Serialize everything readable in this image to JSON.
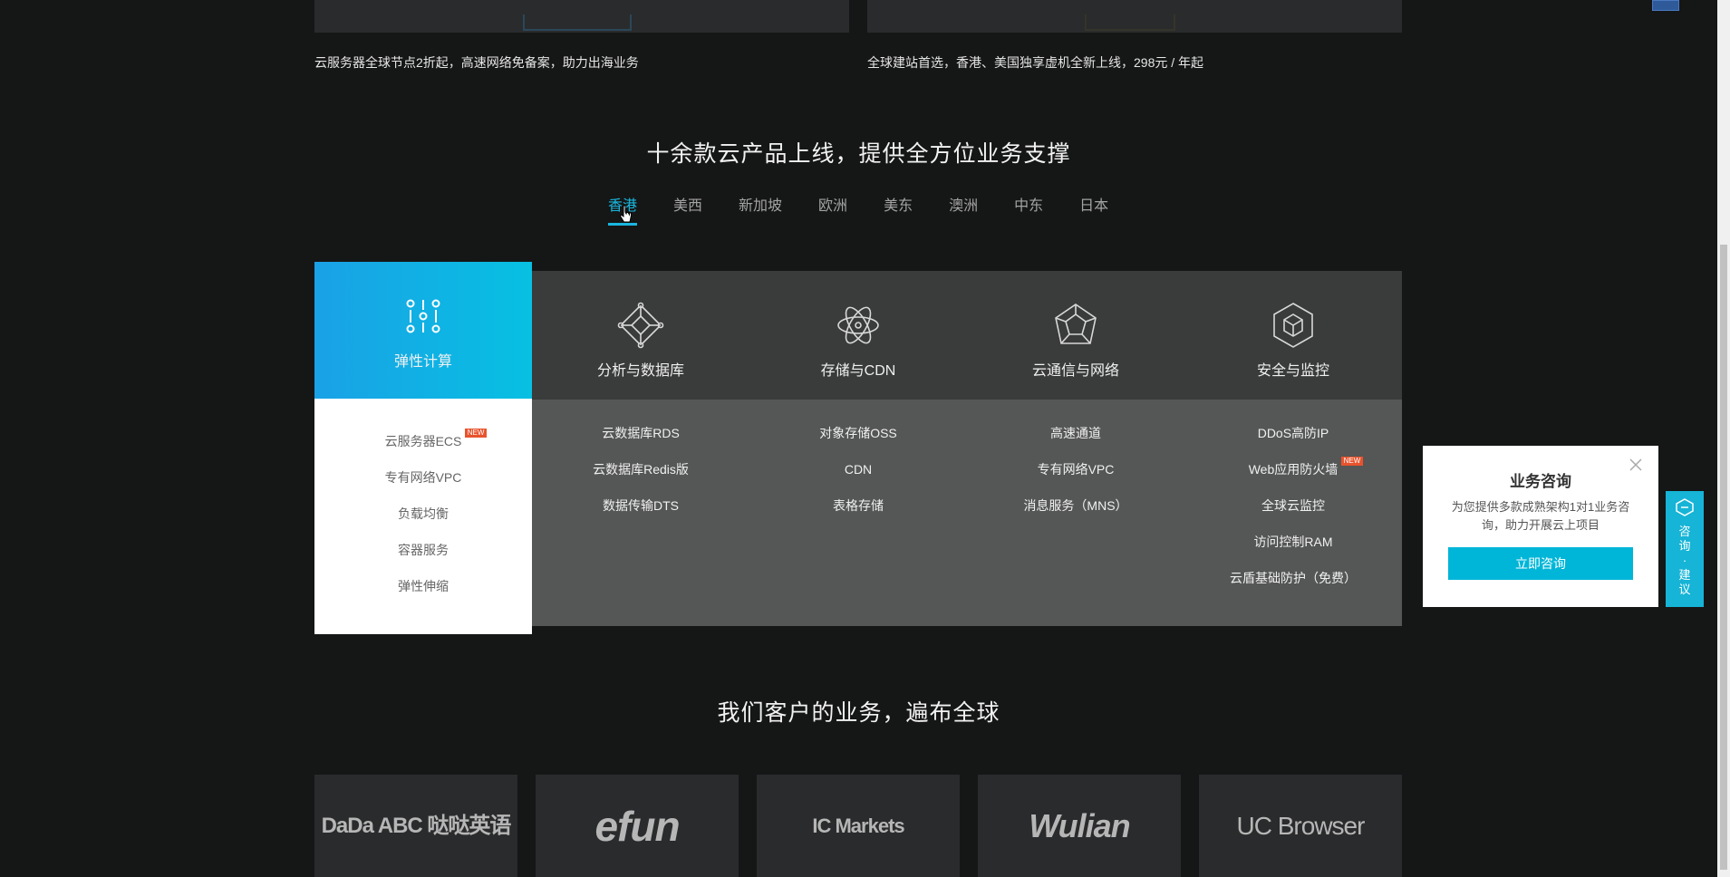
{
  "banners": [
    {
      "caption": "云服务器全球节点2折起，高速网络免备案，助力出海业务"
    },
    {
      "caption": "全球建站首选，香港、美国独享虚机全新上线，298元 / 年起"
    }
  ],
  "products_section": {
    "title": "十余款云产品上线，提供全方位业务支撑",
    "tabs": [
      "香港",
      "美西",
      "新加坡",
      "欧洲",
      "美东",
      "澳洲",
      "中东",
      "日本"
    ],
    "active_tab": "香港",
    "columns": [
      {
        "title": "弹性计算",
        "icon": "compute-grid-icon",
        "active": true,
        "items": [
          {
            "label": "云服务器ECS",
            "badge": "NEW"
          },
          {
            "label": "专有网络VPC"
          },
          {
            "label": "负载均衡"
          },
          {
            "label": "容器服务"
          },
          {
            "label": "弹性伸缩"
          }
        ]
      },
      {
        "title": "分析与数据库",
        "icon": "database-network-icon",
        "items": [
          {
            "label": "云数据库RDS"
          },
          {
            "label": "云数据库Redis版"
          },
          {
            "label": "数据传输DTS"
          }
        ]
      },
      {
        "title": "存储与CDN",
        "icon": "atom-storage-icon",
        "items": [
          {
            "label": "对象存储OSS"
          },
          {
            "label": "CDN"
          },
          {
            "label": "表格存储"
          }
        ]
      },
      {
        "title": "云通信与网络",
        "icon": "network-polygon-icon",
        "items": [
          {
            "label": "高速通道"
          },
          {
            "label": "专有网络VPC"
          },
          {
            "label": "消息服务（MNS）"
          }
        ]
      },
      {
        "title": "安全与监控",
        "icon": "security-cube-icon",
        "items": [
          {
            "label": "DDoS高防IP"
          },
          {
            "label": "Web应用防火墙",
            "badge": "NEW"
          },
          {
            "label": "全球云监控"
          },
          {
            "label": "访问控制RAM"
          },
          {
            "label": "云盾基础防护（免费）"
          }
        ]
      }
    ]
  },
  "clients_section": {
    "title": "我们客户的业务，遍布全球",
    "clients": [
      "DaDa ABC 哒哒英语",
      "efun",
      "IC Markets",
      "Wulian",
      "UC Browser"
    ]
  },
  "consult_popup": {
    "title": "业务咨询",
    "description": "为您提供多款成熟架构1对1业务咨询，助力开展云上项目",
    "button_label": "立即咨询",
    "close_icon": "close-icon"
  },
  "side_tab": {
    "label": "咨询·建议",
    "icon": "chat-hexagon-icon"
  },
  "colors": {
    "accent": "#19b7de",
    "active_gradient_start": "#1aa1e6",
    "active_gradient_end": "#07c0e2",
    "badge": "#e8532d",
    "background": "#151616"
  }
}
